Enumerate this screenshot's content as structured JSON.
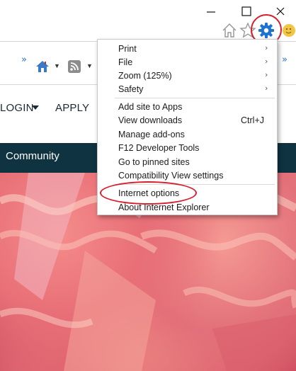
{
  "nav": {
    "login_label": "LOGIN",
    "apply_label": "APPLY"
  },
  "banner": {
    "community_label": "Community"
  },
  "menu": {
    "items": [
      {
        "label": "Print",
        "shortcut": "",
        "submenu": true
      },
      {
        "label": "File",
        "shortcut": "",
        "submenu": true
      },
      {
        "label": "Zoom (125%)",
        "shortcut": "",
        "submenu": true
      },
      {
        "label": "Safety",
        "shortcut": "",
        "submenu": true
      },
      {
        "label": "Add site to Apps",
        "shortcut": "",
        "submenu": false
      },
      {
        "label": "View downloads",
        "shortcut": "Ctrl+J",
        "submenu": false
      },
      {
        "label": "Manage add-ons",
        "shortcut": "",
        "submenu": false
      },
      {
        "label": "F12 Developer Tools",
        "shortcut": "",
        "submenu": false
      },
      {
        "label": "Go to pinned sites",
        "shortcut": "",
        "submenu": false
      },
      {
        "label": "Compatibility View settings",
        "shortcut": "",
        "submenu": false
      },
      {
        "label": "Internet options",
        "shortcut": "",
        "submenu": false
      },
      {
        "label": "About Internet Explorer",
        "shortcut": "",
        "submenu": false
      }
    ],
    "arrow_glyph": "›"
  },
  "toolbar": {
    "chevron_glyph": "»"
  },
  "icons": {
    "gear": "gear-icon",
    "home": "home-icon",
    "favorites": "star-icon",
    "feedback": "smiley-icon",
    "rss": "rss-icon"
  },
  "colors": {
    "gear_blue": "#1e73d2",
    "highlight_red": "#d81e2a",
    "banner_dark": "#0f3340"
  }
}
